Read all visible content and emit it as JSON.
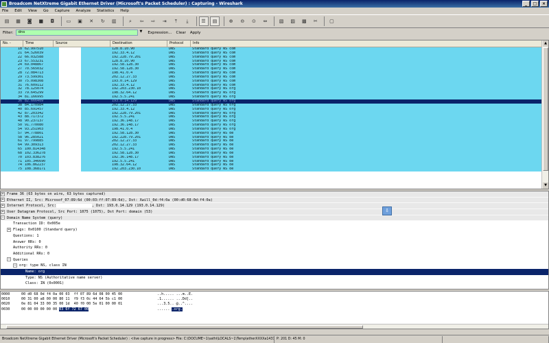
{
  "window": {
    "title": "Broadcom NetXtreme Gigabit Ethernet Driver (Microsoft's Packet Scheduler) : Capturing - Wireshark"
  },
  "menu": [
    "File",
    "Edit",
    "View",
    "Go",
    "Capture",
    "Analyze",
    "Statistics",
    "Help"
  ],
  "filter": {
    "label": "Filter:",
    "value": "dns",
    "expression": "Expression...",
    "clear": "Clear",
    "apply": "Apply"
  },
  "columns": {
    "no": "No. -",
    "time": "Time",
    "source": "Source",
    "destination": "Destination",
    "protocol": "Protocol",
    "info": "Info"
  },
  "packets": [
    {
      "no": "18",
      "time": "62.997510",
      "src": "",
      "dst": "128.8.10.90",
      "proto": "DNS",
      "info": "Standard query NS com"
    },
    {
      "no": "21",
      "time": "64.526039",
      "src": "",
      "dst": "192.33.4.12",
      "proto": "DNS",
      "info": "Standard query NS com"
    },
    {
      "no": "22",
      "time": "66.032588",
      "src": "",
      "dst": "192.228.79.201",
      "proto": "DNS",
      "info": "Standard query NS com"
    },
    {
      "no": "23",
      "time": "67.553231",
      "src": "",
      "dst": "128.8.10.90",
      "proto": "DNS",
      "info": "Standard query NS com"
    },
    {
      "no": "24",
      "time": "69.048867",
      "src": "",
      "dst": "192.58.128.30",
      "proto": "DNS",
      "info": "Standard query NS com"
    },
    {
      "no": "27",
      "time": "70.565032",
      "src": "",
      "dst": "192.58.128.30",
      "proto": "DNS",
      "info": "Standard query NS com"
    },
    {
      "no": "28",
      "time": "72.084713",
      "src": "",
      "dst": "198.41.0.4",
      "proto": "DNS",
      "info": "Standard query NS com"
    },
    {
      "no": "29",
      "time": "73.599301",
      "src": "",
      "dst": "202.12.27.33",
      "proto": "DNS",
      "info": "Standard query NS com"
    },
    {
      "no": "30",
      "time": "75.098308",
      "src": "",
      "dst": "193.0.14.129",
      "proto": "DNS",
      "info": "Standard query NS com"
    },
    {
      "no": "31",
      "time": "76.609112",
      "src": "",
      "dst": "192.33.4.12",
      "proto": "DNS",
      "info": "Standard query NS com"
    },
    {
      "no": "32",
      "time": "78.125074",
      "src": "",
      "dst": "192.203.230.10",
      "proto": "DNS",
      "info": "Standard query NS org"
    },
    {
      "no": "33",
      "time": "79.645299",
      "src": "",
      "dst": "198.32.64.12",
      "proto": "DNS",
      "info": "Standard query NS org"
    },
    {
      "no": "34",
      "time": "81.166995",
      "src": "",
      "dst": "192.5.5.241",
      "proto": "DNS",
      "info": "Standard query NS org"
    },
    {
      "no": "36",
      "time": "82.666409",
      "src": "",
      "dst": "193.0.14.129",
      "proto": "DNS",
      "info": "Standard query NS org"
    },
    {
      "no": "38",
      "time": "84.170984",
      "src": "",
      "dst": "202.12.27.33",
      "proto": "DNS",
      "info": "Standard query NS org"
    },
    {
      "no": "40",
      "time": "85.691457",
      "src": "",
      "dst": "192.33.4.12",
      "proto": "DNS",
      "info": "Standard query NS org"
    },
    {
      "no": "42",
      "time": "87.203342",
      "src": "",
      "dst": "192.228.79.201",
      "proto": "DNS",
      "info": "Standard query NS org"
    },
    {
      "no": "43",
      "time": "88.717372",
      "src": "",
      "dst": "192.5.5.241",
      "proto": "DNS",
      "info": "Standard query NS org"
    },
    {
      "no": "48",
      "time": "90.237137",
      "src": "",
      "dst": "192.36.148.17",
      "proto": "DNS",
      "info": "Standard query NS org"
    },
    {
      "no": "50",
      "time": "91.770080",
      "src": "",
      "dst": "192.36.148.17",
      "proto": "DNS",
      "info": "Standard query NS org"
    },
    {
      "no": "54",
      "time": "93.251903",
      "src": "",
      "dst": "198.41.0.4",
      "proto": "DNS",
      "info": "Standard query NS org"
    },
    {
      "no": "57",
      "time": "94.778801",
      "src": "",
      "dst": "192.58.128.30",
      "proto": "DNS",
      "info": "Standard query NS de"
    },
    {
      "no": "58",
      "time": "96.285021",
      "src": "",
      "dst": "192.228.79.201",
      "proto": "DNS",
      "info": "Standard query NS de"
    },
    {
      "no": "61",
      "time": "97.799885",
      "src": "",
      "dst": "202.12.27.33",
      "proto": "DNS",
      "info": "Standard query NS de"
    },
    {
      "no": "64",
      "time": "99.309313",
      "src": "",
      "dst": "202.12.27.33",
      "proto": "DNS",
      "info": "Standard query NS de"
    },
    {
      "no": "65",
      "time": "100.814348",
      "src": "",
      "dst": "192.5.5.241",
      "proto": "DNS",
      "info": "Standard query NS de"
    },
    {
      "no": "68",
      "time": "102.336278",
      "src": "",
      "dst": "192.58.128.30",
      "proto": "DNS",
      "info": "Standard query NS de"
    },
    {
      "no": "70",
      "time": "103.838276",
      "src": "",
      "dst": "192.36.148.17",
      "proto": "DNS",
      "info": "Standard query NS de"
    },
    {
      "no": "71",
      "time": "105.346690",
      "src": "",
      "dst": "192.5.5.241",
      "proto": "DNS",
      "info": "Standard query NS de"
    },
    {
      "no": "74",
      "time": "106.862237",
      "src": "",
      "dst": "198.32.64.12",
      "proto": "DNS",
      "info": "Standard query NS de"
    },
    {
      "no": "75",
      "time": "108.368171",
      "src": "",
      "dst": "192.203.230.10",
      "proto": "DNS",
      "info": "Standard query NS de"
    }
  ],
  "selected_packet_index": 13,
  "details": {
    "frame": "Frame 36 (63 bytes on wire, 63 bytes captured)",
    "ethernet_a": "Ethernet II, Src: Microsof_07:89:6d (00:03:ff:07:89:6d), Dst: Xwill_0d:f4:0a (00:d0:68:0d:f4:0a)",
    "ip_a": "Internet Protocol, Src:",
    "ip_b": ", Dst: 193.0.14.129 (193.0.14.129)",
    "udp": "User Datagram Protocol, Src Port: 1075 (1075), Dst Port: domain (53)",
    "dns": "Domain Name System (query)",
    "txid": "Transaction ID: 0x005e",
    "flags": "Flags: 0x0100 (Standard query)",
    "questions": "Questions: 1",
    "answer_rrs": "Answer RRs: 0",
    "authority_rrs": "Authority RRs: 0",
    "additional_rrs": "Additional RRs: 0",
    "queries": "Queries",
    "query": "org: type NS, class IN",
    "name": "Name: org",
    "type": "Type: NS (Authoritative name server)",
    "class": "Class: IN (0x0001)"
  },
  "bytes": [
    {
      "off": "0000",
      "hex_a": "00 d0 68 0d f4 0a 00 03  ff 07 89 6d 08 00 45 00",
      "hex_b": "",
      "ascii_a": "..h..... ...m..E.",
      "ascii_b": ""
    },
    {
      "off": "0010",
      "hex_a": "00 31 00 a8 00 00 80 11  f9 f3 0c 44 64 5b c1 00",
      "hex_b": "",
      "ascii_a": ".1...... ...Dd[..",
      "ascii_b": ""
    },
    {
      "off": "0020",
      "hex_a": "0e 81 04 33 00 35 00 1d  40 f0 00 5e 01 00 00 01",
      "hex_b": "",
      "ascii_a": "...3.5.. @..^....",
      "ascii_b": ""
    },
    {
      "off": "0030",
      "hex_a": "00 00 00 00 00 00 ",
      "hex_b": "03 6f 72 67 00",
      "ascii_a": "...... ",
      "ascii_b": ".org."
    }
  ],
  "status": {
    "left": "Broadcom NetXtreme Gigabit Ethernet Driver (Microsoft's Packet Scheduler) : <live capture in progress> File: C:\\DOCUME~1\\sathi\\LOCALS~1\\Temp\\etherXXXXa14312 26...",
    "mid": "P: 201 D: 45 M: 0",
    "right": ""
  },
  "colors": {
    "dns_row": "#6cd7f0",
    "selected": "#0a246a",
    "filter_ok": "#afffaf"
  },
  "toolbar_icons": [
    "interfaces-icon",
    "options-icon",
    "start-icon",
    "stop-icon",
    "restart-icon",
    "open-icon",
    "save-icon",
    "close-icon",
    "reload-icon",
    "print-icon",
    "find-icon",
    "back-icon",
    "forward-icon",
    "goto-icon",
    "first-icon",
    "last-icon",
    "autoscroll-icon",
    "colorize-icon",
    "zoom-in-icon",
    "zoom-out-icon",
    "zoom-normal-icon",
    "resize-columns-icon",
    "capture-filters-icon",
    "display-filters-icon",
    "coloring-rules-icon",
    "preferences-icon",
    "help-icon"
  ]
}
